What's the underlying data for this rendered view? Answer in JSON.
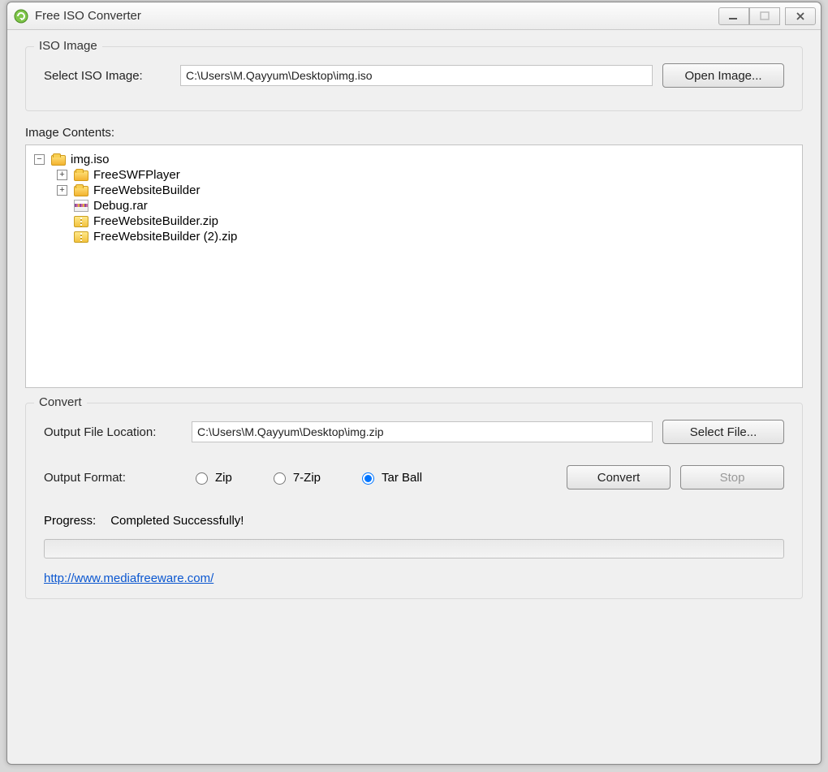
{
  "window": {
    "title": "Free ISO Converter"
  },
  "iso": {
    "groupTitle": "ISO Image",
    "selectLabel": "Select ISO Image:",
    "path": "C:\\Users\\M.Qayyum\\Desktop\\img.iso",
    "openButton": "Open Image..."
  },
  "contents": {
    "label": "Image Contents:",
    "root": "img.iso",
    "rootExpanded": true,
    "children": [
      {
        "type": "folder",
        "name": "FreeSWFPlayer",
        "expandable": true
      },
      {
        "type": "folder",
        "name": "FreeWebsiteBuilder",
        "expandable": true
      },
      {
        "type": "rar",
        "name": "Debug.rar",
        "expandable": false
      },
      {
        "type": "zip",
        "name": "FreeWebsiteBuilder.zip",
        "expandable": false
      },
      {
        "type": "zip",
        "name": "FreeWebsiteBuilder (2).zip",
        "expandable": false
      }
    ]
  },
  "convert": {
    "groupTitle": "Convert",
    "outputLabel": "Output File Location:",
    "outputPath": "C:\\Users\\M.Qayyum\\Desktop\\img.zip",
    "selectFileButton": "Select File...",
    "formatLabel": "Output Format:",
    "formats": {
      "zip": "Zip",
      "sevenzip": "7-Zip",
      "tarball": "Tar Ball"
    },
    "selectedFormat": "tarball",
    "convertButton": "Convert",
    "stopButton": "Stop",
    "progressLabel": "Progress:",
    "progressStatus": "Completed Successfully!",
    "link": "http://www.mediafreeware.com/"
  }
}
